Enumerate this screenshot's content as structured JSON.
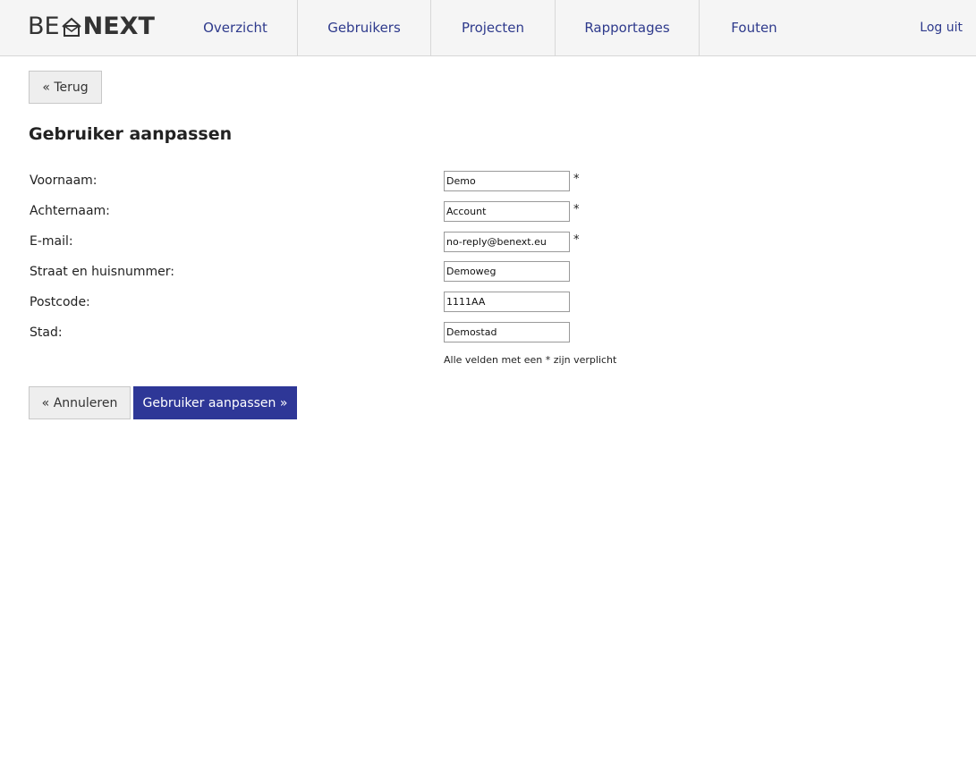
{
  "header": {
    "logo": {
      "left": "BE",
      "right": "NEXT"
    },
    "nav": [
      {
        "label": "Overzicht"
      },
      {
        "label": "Gebruikers"
      },
      {
        "label": "Projecten"
      },
      {
        "label": "Rapportages"
      },
      {
        "label": "Fouten"
      }
    ],
    "logout_label": "Log uit"
  },
  "back_button": "« Terug",
  "page_title": "Gebruiker aanpassen",
  "form": {
    "fields": [
      {
        "label": "Voornaam:",
        "value": "Demo",
        "required_mark": "*"
      },
      {
        "label": "Achternaam:",
        "value": "Account",
        "required_mark": "*"
      },
      {
        "label": "E-mail:",
        "value": "no-reply@benext.eu",
        "required_mark": "*"
      },
      {
        "label": "Straat en huisnummer:",
        "value": "Demoweg"
      },
      {
        "label": "Postcode:",
        "value": "1111AA"
      },
      {
        "label": "Stad:",
        "value": "Demostad"
      }
    ],
    "required_note": "Alle velden met een * zijn verplicht",
    "cancel_label": "« Annuleren",
    "submit_label": "Gebruiker aanpassen »"
  },
  "colors": {
    "primary": "#2e3797",
    "nav_text": "#2e3a8c",
    "header_bg": "#f5f5f5"
  }
}
